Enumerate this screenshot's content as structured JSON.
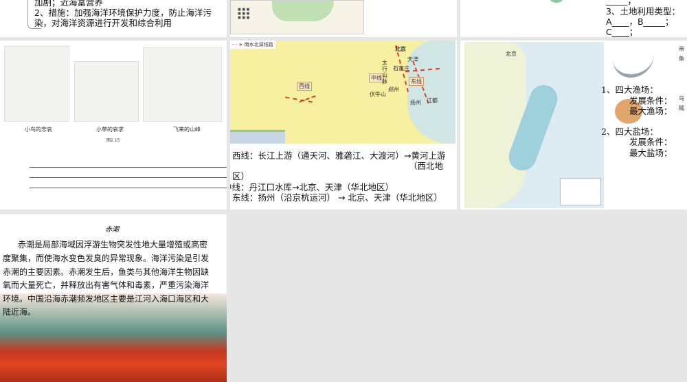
{
  "slides": [
    {
      "lines": [
        "加剧；近海富营养",
        "2、措施：加强海洋环境保护力度，防止海洋污",
        "染，对海洋资源进行开发和综合利用"
      ]
    },
    {
      "caption": ""
    },
    {
      "lines": [
        "_____；",
        "3、土地利用类型：",
        "A____，B_____；",
        "C____；"
      ]
    },
    {
      "cartoons": [
        "小鸟的悲哀",
        "小草的哀求",
        "飞来的山峰"
      ],
      "figure": "图2.15",
      "blanks": [
        "：",
        "：",
        "："
      ]
    },
    {
      "legend": "南水北调线路",
      "cities": [
        "北京",
        "天津",
        "石家庄",
        "郑州",
        "扬州",
        "江都"
      ],
      "routes": [
        "西线",
        "中线",
        "东线"
      ],
      "mountains": [
        "太行山脉",
        "伏牛山"
      ],
      "lines": [
        "西线：长江上游（通天河、雅砻江、大渡河）→黄河上游",
        "（西北地",
        "区）",
        "中线：丹江口水库→北京、天津（华北地区）",
        "东线：扬州（沿京杭运河） → 北京、天津（华北地区）"
      ]
    },
    {
      "lines": [
        "1、四大渔场：",
        "发展条件：",
        "最大渔场：",
        "2、四大盐场：",
        "发展条件：",
        "最大盐场："
      ],
      "side_labels": [
        "带鱼",
        "乌贼"
      ],
      "map_city": "北京"
    },
    {
      "title": "赤潮",
      "paragraph": [
        "赤潮是局部海域因浮游生物突发性地大量增殖或高密",
        "度聚集，而使海水变色发臭的异常现象。海洋污染是引发",
        "赤潮的主要因素。赤潮发生后，鱼类与其他海洋生物因缺",
        "氧而大量死亡，并释放出有害气体和毒素，严重污染海洋",
        "环境。中国沿海赤潮频发地区主要是江河入海口海区和大",
        "陆近海。"
      ]
    }
  ],
  "colors": {
    "background": "#e6e6e6",
    "route": "#d9432a",
    "map_land": "#f6f0a0",
    "sea": "#cfe6e4"
  }
}
